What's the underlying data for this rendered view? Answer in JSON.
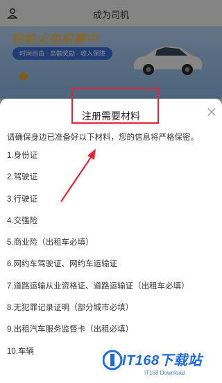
{
  "header": {
    "title": "成为司机",
    "user_icon": "user-icon"
  },
  "banner": {
    "headline": "司机火热招募中",
    "tagline": "时间自由 · 高额奖励 · 收入保障"
  },
  "sheet": {
    "title": "注册需要材料",
    "close_icon": "close-icon",
    "intro": "请确保身边已准备好以下材料，您的信息将严格保密。",
    "items": [
      "1.身份证",
      "2.驾驶证",
      "3.行驶证",
      "4.交强险",
      "5.商业险（出租车必填）",
      "6.网约车驾驶证、网约车运输证",
      "7.道路运输从业资格证、道路运输证（出租车必填）",
      "8.无犯罪记录证明（部分城市必填）",
      "9.出租汽车服务监督卡（出租必填）",
      "10.车辆"
    ]
  },
  "annotation": {
    "color": "#e52535"
  },
  "watermark": {
    "main": "IT168下载站",
    "sub": "IT168 Download"
  }
}
